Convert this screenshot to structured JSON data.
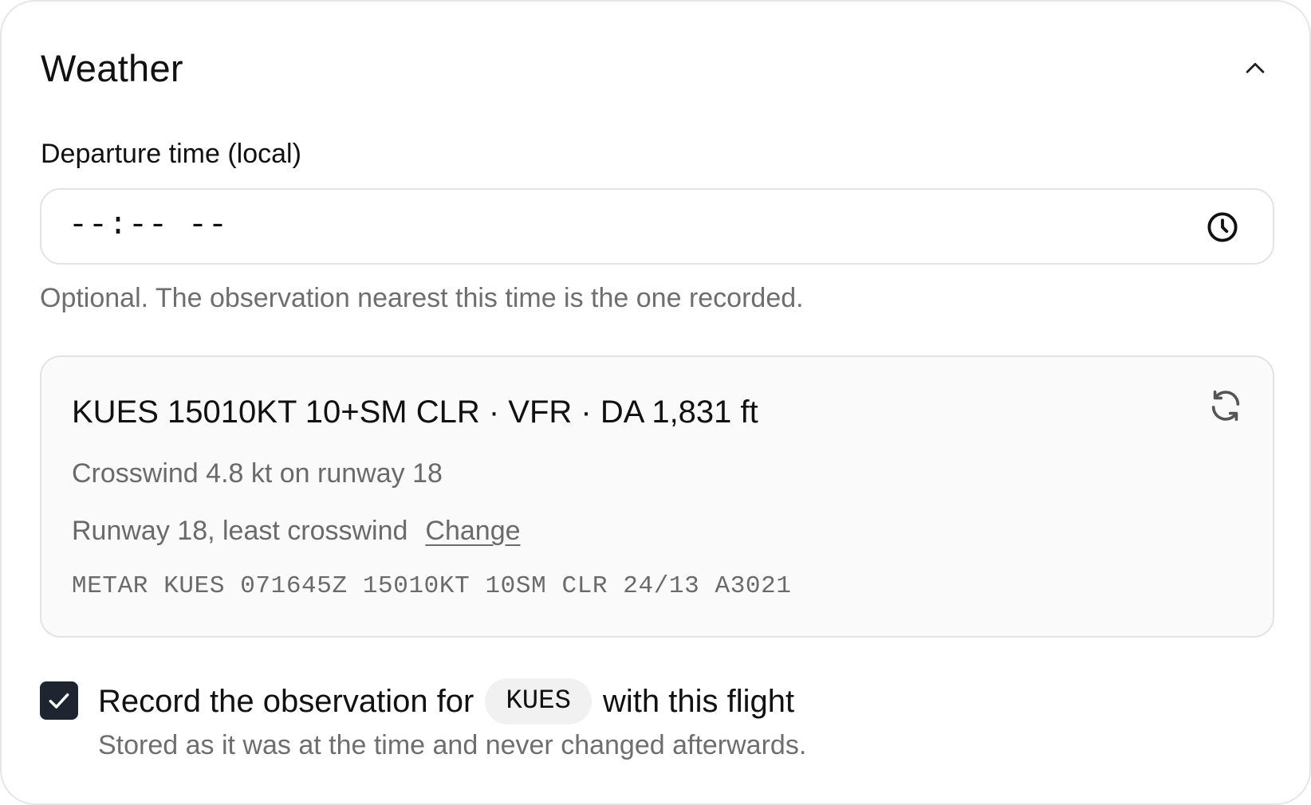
{
  "section": {
    "title": "Weather",
    "collapse_icon": "chevron-up-icon"
  },
  "departure": {
    "label": "Departure time (local)",
    "value": "--:-- --",
    "clock_icon": "clock-icon",
    "help": "Optional. The observation nearest this time is the one recorded."
  },
  "observation": {
    "summary": "KUES 15010KT 10+SM CLR · VFR · DA 1,831 ft",
    "refresh_icon": "refresh-icon",
    "crosswind": "Crosswind 4.8 kt on runway 18",
    "runway": "Runway 18, least crosswind",
    "change_label": "Change",
    "raw_metar": "METAR KUES 071645Z 15010KT 10SM CLR 24/13 A3021"
  },
  "record": {
    "checked": true,
    "label_before": "Record the observation for",
    "station": "KUES",
    "label_after": "with this flight",
    "subtext": "Stored as it was at the time and never changed afterwards."
  },
  "colors": {
    "checkbox_fill": "#1e2430",
    "muted_text": "#6e6e6e",
    "border": "#e3e3e3",
    "panel_bg": "#fafafa"
  }
}
